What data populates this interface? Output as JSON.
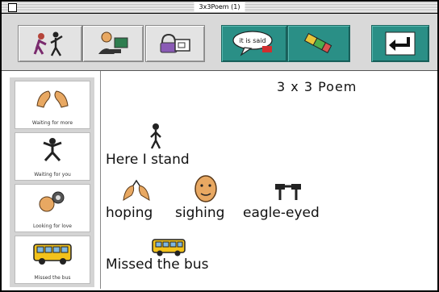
{
  "window": {
    "title": "3x3Poem (1)"
  },
  "toolbar": {
    "buttons": [
      {
        "icon": "run-figure-icon"
      },
      {
        "icon": "person-board-icon"
      },
      {
        "icon": "purse-card-icon"
      },
      {
        "icon": "speech-bubble-icon",
        "bubble_text": "it is said"
      },
      {
        "icon": "eraser-icon"
      },
      {
        "icon": "enter-arrow-icon"
      }
    ]
  },
  "sidebar": {
    "items": [
      {
        "label": "Waiting for more",
        "icon": "hands-icon"
      },
      {
        "label": "Waiting for you",
        "icon": "reaching-icon"
      },
      {
        "label": "Looking for love",
        "icon": "looking-icon"
      },
      {
        "label": "Missed the bus",
        "icon": "bus-icon"
      }
    ]
  },
  "poem": {
    "title": "3 x 3 Poem",
    "line1": "Here I stand",
    "line2_words": [
      "hoping",
      "sighing",
      "eagle-eyed"
    ],
    "line3": "Missed the bus"
  },
  "colors": {
    "teal": "#2a8f86",
    "bus_yellow": "#f2c21b",
    "skin": "#e8a862"
  }
}
